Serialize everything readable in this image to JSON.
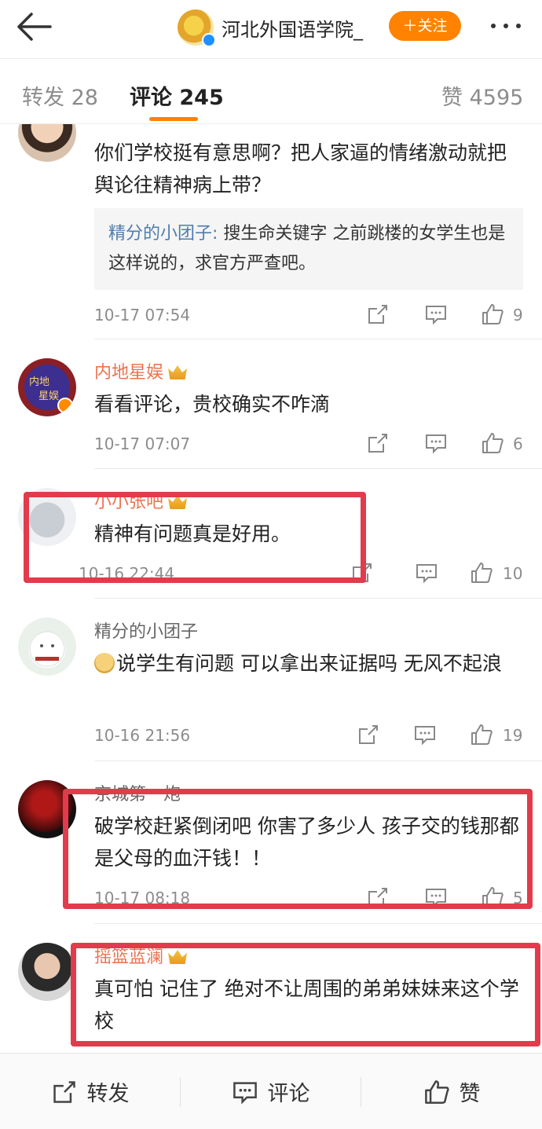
{
  "header": {
    "account_name": "河北外国语学院_",
    "follow_label": "＋关注"
  },
  "tabs": {
    "repost": "转发 28",
    "comment": "评论 245",
    "like": "赞 4595"
  },
  "comments": [
    {
      "author": "",
      "text": "你们学校挺有意思啊？把人家逼的情绪激动就把舆论往精神病上带？",
      "quote_author": "精分的小团子:",
      "quote_text": " 搜生命关键字 之前跳楼的女学生也是这样说的，求官方严查吧。",
      "time": "10-17 07:54",
      "likes": "9"
    },
    {
      "author": "内地星娱",
      "text": "看看评论，贵校确实不咋滴",
      "time": "10-17 07:07",
      "likes": "6"
    },
    {
      "author": "小小张吧",
      "text": "精神有问题真是好用。",
      "time": "10-16 22:44",
      "likes": "10"
    },
    {
      "author": "精分的小团子",
      "text": "说学生有问题 可以拿出来证据吗 无风不起浪",
      "time": "10-16 21:56",
      "likes": "19"
    },
    {
      "author": "京城第一炮",
      "text": "破学校赶紧倒闭吧 你害了多少人 孩子交的钱那都是父母的血汗钱！！",
      "time": "10-17 08:18",
      "likes": "5"
    },
    {
      "author": "摇篮蓝澜",
      "text": "真可怕 记住了 绝对不让周围的弟弟妹妹来这个学校"
    }
  ],
  "bottom_bar": {
    "repost": "转发",
    "comment": "评论",
    "like": "赞"
  },
  "colors": {
    "accent": "#ff8200",
    "highlight_box": "#e23b4b",
    "vip_name": "#eb7350",
    "quote_name": "#507daf"
  }
}
